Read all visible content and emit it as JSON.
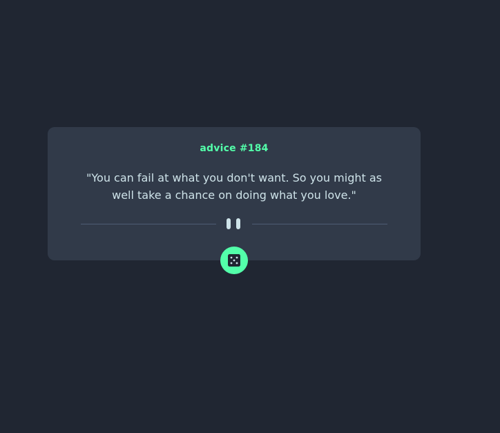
{
  "card": {
    "label": "advice #184",
    "quote": "\"You can fail at what you don't want. So you might as well take a chance on doing what you love.\""
  },
  "button": {
    "icon": "dice-icon",
    "action_label": ""
  },
  "colors": {
    "background": "#202632",
    "card": "#313a49",
    "accent": "#53ffaa",
    "text": "#cee3e9",
    "divider": "#4f5d74"
  }
}
